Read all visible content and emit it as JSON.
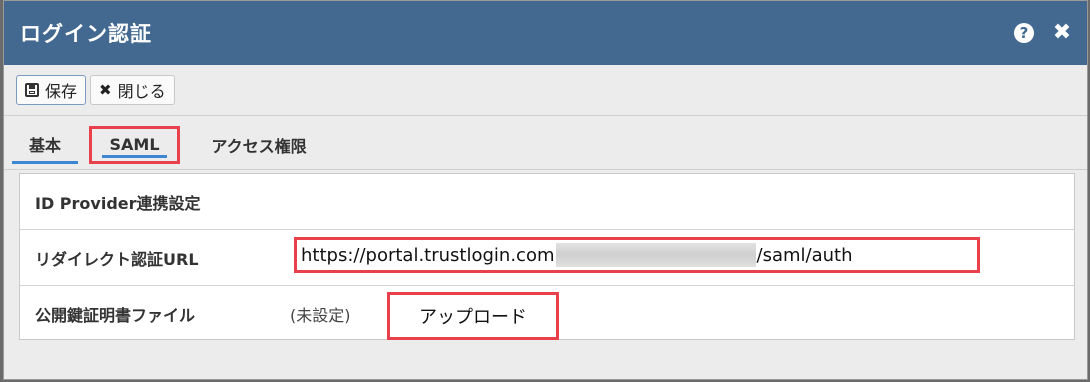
{
  "window": {
    "title": "ログイン認証"
  },
  "toolbar": {
    "save_label": "保存",
    "close_label": "閉じる"
  },
  "tabs": [
    {
      "label": "基本"
    },
    {
      "label": "SAML"
    },
    {
      "label": "アクセス権限"
    }
  ],
  "panel": {
    "section_title": "ID Provider連携設定",
    "redirect_label": "リダイレクト認証URL",
    "redirect_url_prefix": "https://portal.trustlogin.com",
    "redirect_url_suffix": "/saml/auth",
    "cert_label": "公開鍵証明書ファイル",
    "cert_status": "(未設定)",
    "upload_label": "アップロード"
  },
  "colors": {
    "titlebar": "#436991",
    "highlight": "#e8414b",
    "tab_underline": "#3d86d1"
  }
}
